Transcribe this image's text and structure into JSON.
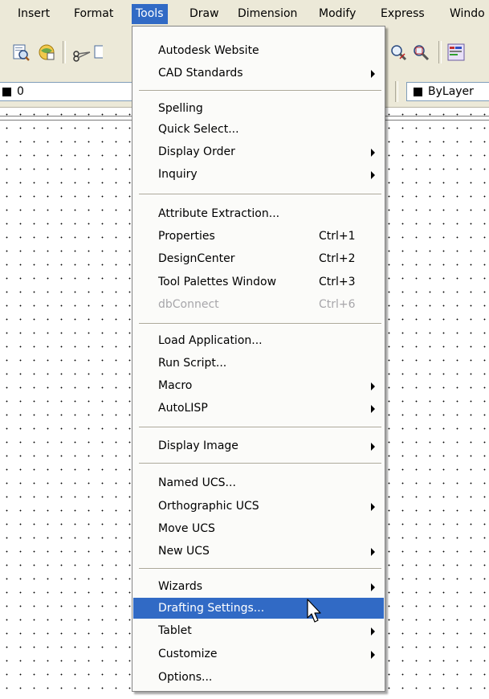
{
  "menubar": {
    "items": [
      {
        "label": "Insert"
      },
      {
        "label": "Format"
      },
      {
        "label": "Tools"
      },
      {
        "label": "Draw"
      },
      {
        "label": "Dimension"
      },
      {
        "label": "Modify"
      },
      {
        "label": "Express"
      },
      {
        "label": "Windo"
      }
    ],
    "active_index": 2
  },
  "toolbar": {
    "layer_combo_value": "0",
    "color_combo_value": "ByLayer",
    "icons": [
      "print-preview-icon",
      "publish-icon",
      "cut-icon",
      "copy-icon",
      "zoom-realtime-icon",
      "zoom-window-icon",
      "properties-icon"
    ]
  },
  "tools_menu": {
    "items": [
      {
        "label": "Autodesk Website",
        "shortcut": "",
        "submenu": false
      },
      {
        "label": "CAD Standards",
        "shortcut": "",
        "submenu": true
      },
      {
        "label": "Spelling",
        "shortcut": "",
        "submenu": false
      },
      {
        "label": "Quick Select...",
        "shortcut": "",
        "submenu": false
      },
      {
        "label": "Display Order",
        "shortcut": "",
        "submenu": true
      },
      {
        "label": "Inquiry",
        "shortcut": "",
        "submenu": true
      },
      {
        "label": "Attribute Extraction...",
        "shortcut": "",
        "submenu": false
      },
      {
        "label": "Properties",
        "shortcut": "Ctrl+1",
        "submenu": false
      },
      {
        "label": "DesignCenter",
        "shortcut": "Ctrl+2",
        "submenu": false
      },
      {
        "label": "Tool Palettes Window",
        "shortcut": "Ctrl+3",
        "submenu": false
      },
      {
        "label": "dbConnect",
        "shortcut": "Ctrl+6",
        "submenu": false,
        "disabled": true
      },
      {
        "label": "Load Application...",
        "shortcut": "",
        "submenu": false
      },
      {
        "label": "Run Script...",
        "shortcut": "",
        "submenu": false
      },
      {
        "label": "Macro",
        "shortcut": "",
        "submenu": true
      },
      {
        "label": "AutoLISP",
        "shortcut": "",
        "submenu": true
      },
      {
        "label": "Display Image",
        "shortcut": "",
        "submenu": true
      },
      {
        "label": "Named UCS...",
        "shortcut": "",
        "submenu": false
      },
      {
        "label": "Orthographic UCS",
        "shortcut": "",
        "submenu": true
      },
      {
        "label": "Move UCS",
        "shortcut": "",
        "submenu": false
      },
      {
        "label": "New UCS",
        "shortcut": "",
        "submenu": true
      },
      {
        "label": "Wizards",
        "shortcut": "",
        "submenu": true
      },
      {
        "label": "Drafting Settings...",
        "shortcut": "",
        "submenu": false,
        "highlighted": true
      },
      {
        "label": "Tablet",
        "shortcut": "",
        "submenu": true
      },
      {
        "label": "Customize",
        "shortcut": "",
        "submenu": true
      },
      {
        "label": "Options...",
        "shortcut": "",
        "submenu": false
      }
    ]
  },
  "colors": {
    "highlight": "#316ac5",
    "chrome": "#ece9d8",
    "menu_bg": "#fbfbf9",
    "disabled_text": "#a7a6aa"
  }
}
